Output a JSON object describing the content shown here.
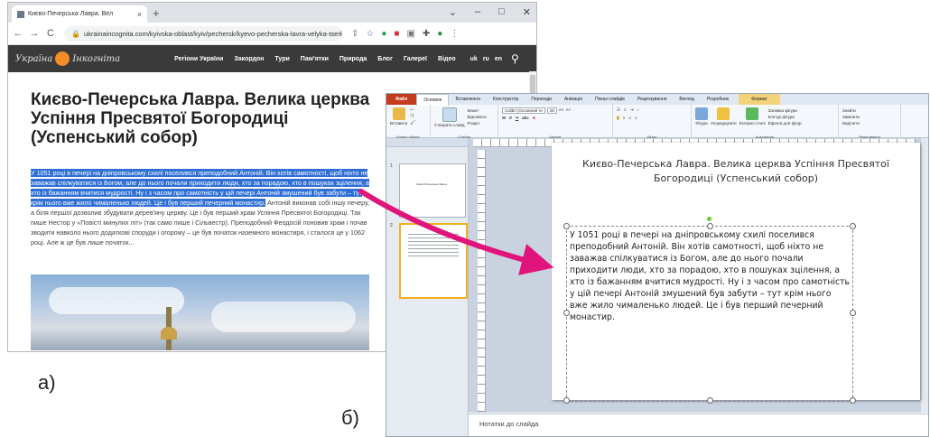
{
  "browser": {
    "tab_title": "Києво-Печерська Лавра. Вел",
    "new_tab": "+",
    "url": "ukrainaincognita.com/kyivska-oblast/kyiv/pechersk/kyevo-pecherska-lavra-velyka-tserkva-uspinnya-pre...",
    "logo_left": "Україна",
    "logo_right": "Інкогніта",
    "nav": [
      "Регіони України",
      "Закордон",
      "Тури",
      "Пам'ятки",
      "Природа",
      "Блог",
      "Галереї",
      "Відео"
    ],
    "langs": [
      "uk",
      "ru",
      "en"
    ],
    "article_title": "Києво-Печерська Лавра. Велика церква Успіння Пресвятої Богородиці (Успенський собор)",
    "text_highlighted": "У 1051 році в печері на дніпровському схилі поселився преподобний Антоній. Він хотів самотності, щоб ніхто не заважав спілкуватися із Богом, але до нього почали приходити люди, хто за порадою, хто в пошуках зцілення, а хто із бажанням вчитися мудрості. Ну і з часом про самотність у цій печері Антоній змушений був забути – тут крім нього вже жило чималенько людей. Це і був перший печерний монастир.",
    "text_plain": " Антоній виконав собі іншу печеру, а біля першої дозволив збудувати дерев'яну церкву. Це і був перший храм Успіння Пресвятої Богородиці. Так пише Нестор у «Повісті минулих літ» (так само пише і Сільвестр). Преподобний Феодосій поновив храм і почав зводити навколо нього додаткові споруди і огорожу – це був початок наземного монастиря, і сталося це у 1062 році. Але ж це був лише початок..."
  },
  "labels": {
    "a": "а)",
    "b": "б)"
  },
  "ppt": {
    "tabs": [
      "Файл",
      "Основне",
      "Вставлення",
      "Конструктор",
      "Переходи",
      "Анімація",
      "Показ слайдів",
      "Рецензування",
      "Вигляд",
      "Розробник"
    ],
    "contextual_tab": "Формат",
    "groups": [
      "Буфер обміну",
      "Слайди",
      "Шрифт",
      "Абзац",
      "Креслення",
      "Редагування"
    ],
    "paste_label": "Вставити",
    "new_slide_label": "Створити слайд",
    "layout_label": "Макет",
    "reset_label": "Відновити",
    "section_label": "Розділ",
    "font_name": "Calibri (Основний те",
    "font_size": "28",
    "drawing_items": [
      "Фігури",
      "Упорядкувати",
      "Експрес-стилі"
    ],
    "fill_label": "Заливка фігури",
    "outline_label": "Контур фігури",
    "effects_label": "Ефекти для фігур",
    "find_label": "Знайти",
    "replace_label": "Замінити",
    "select_label": "Виділити",
    "thumb1_text": "Києво-Печерська Лавра...",
    "thumb_numbers": [
      "1",
      "2"
    ],
    "slide_title": "Києво-Печерська Лавра. Велика церква Успіння Пресвятої Богородиці (Успенський собор)",
    "slide_text": "У 1051 році в печері на дніпровському схилі поселився преподобний Антоній. Він хотів самотності, щоб ніхто не заважав спілкуватися із Богом, але до нього почали приходити люди, хто за порадою, хто в пошуках зцілення, а хто із бажанням вчитися мудрості. Ну і з часом про самотність у цій печері Антоній змушений був забути – тут крім нього вже жило чималенько людей. Це і був перший печерний монастир.",
    "notes_placeholder": "Нотатки до слайда"
  },
  "colors": {
    "arrow": "#e0147a",
    "highlight": "#2f6fd6",
    "file_tab": "#c43b1d",
    "site_header": "#3a3a3a"
  }
}
